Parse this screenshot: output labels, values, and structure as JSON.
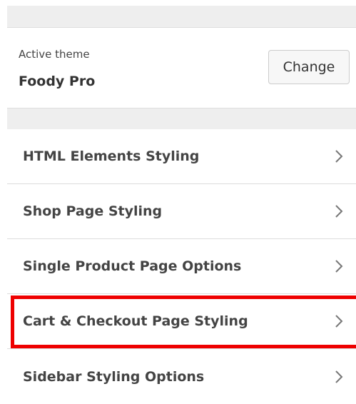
{
  "theme": {
    "label": "Active theme",
    "name": "Foody Pro",
    "change_label": "Change"
  },
  "menu": {
    "items": [
      {
        "label": "HTML Elements Styling",
        "icon": "chevron-right-icon"
      },
      {
        "label": "Shop Page Styling",
        "icon": "chevron-right-icon"
      },
      {
        "label": "Single Product Page Options",
        "icon": "chevron-right-icon"
      },
      {
        "label": "Cart & Checkout Page Styling",
        "icon": "chevron-right-icon",
        "highlighted": true
      },
      {
        "label": "Sidebar Styling Options",
        "icon": "chevron-right-icon"
      }
    ]
  },
  "colors": {
    "highlight": "#ee0000",
    "band": "#eeeeee",
    "text": "#444444"
  }
}
